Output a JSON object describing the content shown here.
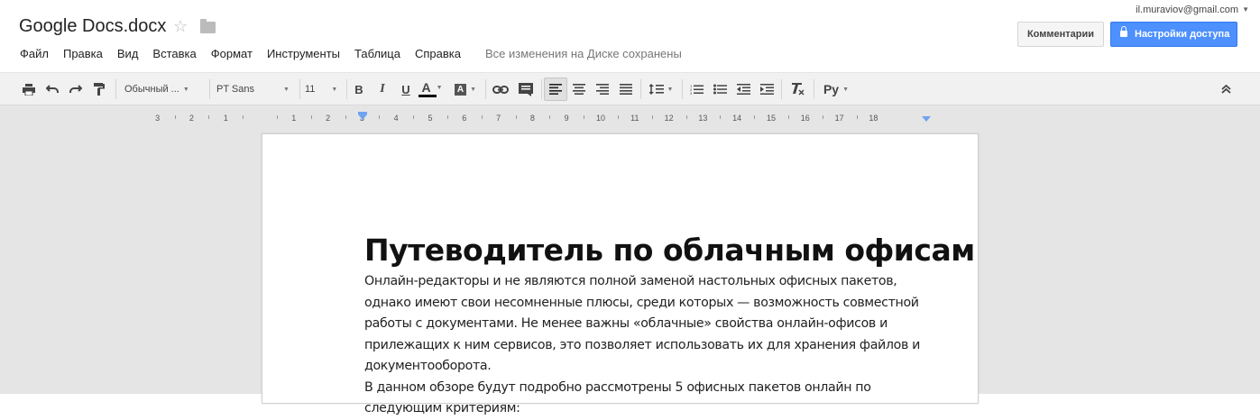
{
  "header": {
    "doc_title": "Google Docs.docx",
    "star_icon": "star-outline-icon",
    "folder_icon": "folder-icon",
    "account_email": "il.muraviov@gmail.com",
    "comments_button": "Комментарии",
    "share_button": "Настройки доступа",
    "accent_color": "#4d90fe"
  },
  "menu": {
    "items": [
      "Файл",
      "Правка",
      "Вид",
      "Вставка",
      "Формат",
      "Инструменты",
      "Таблица",
      "Справка"
    ],
    "save_status": "Все изменения на Диске сохранены"
  },
  "toolbar": {
    "style_select": "Обычный ...",
    "font_select": "PT Sans",
    "size_select": "11",
    "bold": "B",
    "italic": "I",
    "underline": "U",
    "text_color": "A",
    "highlight": "A",
    "input_tools": "Ру"
  },
  "ruler": {
    "numbers": [
      "3",
      "2",
      "1",
      "1",
      "2",
      "3",
      "4",
      "5",
      "6",
      "7",
      "8",
      "9",
      "10",
      "11",
      "12",
      "13",
      "14",
      "15",
      "16",
      "17",
      "18"
    ]
  },
  "document": {
    "heading": "Путеводитель по облачным офисам",
    "paragraphs": [
      "Онлайн-редакторы и не являются полной заменой настольных офисных пакетов, однако имеют свои несомненные плюсы, среди которых — возможность совместной работы с документами. Не менее важны «облачные» свойства онлайн-офисов и прилежащих к ним сервисов, это позволяет использовать их для хранения файлов и документооборота.",
      "В данном обзоре будут подробно рассмотрены 5 офисных пакетов онлайн по следующим критериям:"
    ]
  }
}
